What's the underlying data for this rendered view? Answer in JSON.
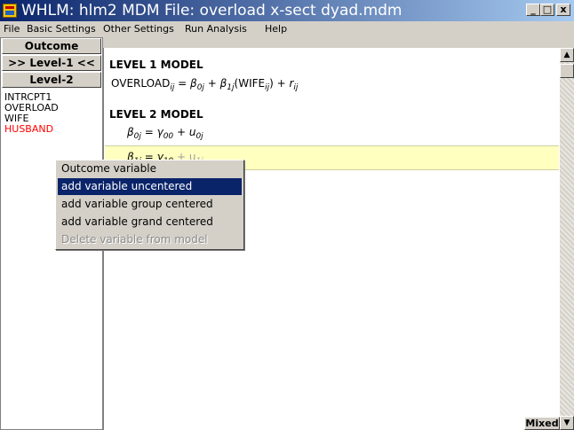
{
  "window": {
    "title": "WHLM: hlm2 MDM File: overload x-sect dyad.mdm",
    "controls": {
      "minimize": "_",
      "maximize": "□",
      "close": "x"
    },
    "title_gradient": [
      "#0a246a",
      "#a6caf0"
    ]
  },
  "menubar": [
    "File",
    "Basic Settings",
    "Other Settings",
    "Run Analysis",
    "Help"
  ],
  "left_panel": {
    "buttons": {
      "outcome": "Outcome",
      "level1": ">> Level-1 <<",
      "level2": "Level-2"
    },
    "variables": [
      "INTRCPT1",
      "OVERLOAD",
      "WIFE",
      "HUSBAND"
    ],
    "highlight_color": "#ff0000"
  },
  "model": {
    "level1_header": "LEVEL 1 MODEL",
    "level1_eq": {
      "lhs": "OVERLOAD",
      "lhs_sub": "ij",
      "b0": "β",
      "b0_sub": "0j",
      "b1": "β",
      "b1_sub": "1j",
      "var": "(WIFE",
      "var_sub": "ij",
      "var_close": ")",
      "r": "r",
      "r_sub": "ij"
    },
    "level2_header": "LEVEL 2 MODEL",
    "level2_eq1": {
      "b": "β",
      "b_sub": "0j",
      "g": "γ",
      "g_sub": "00",
      "u": "u",
      "u_sub": "0j"
    },
    "level2_eq2": {
      "b": "β",
      "b_sub": "1j",
      "g": "γ",
      "g_sub": "10",
      "tail": "+ u",
      "tail_sub": "1j"
    }
  },
  "context_menu": {
    "items": [
      "Outcome variable",
      "add variable uncentered",
      "add variable group centered",
      "add variable grand centered",
      "Delete variable from model"
    ],
    "selected_index": 1,
    "disabled_index": 4,
    "selection_color": "#0a246a"
  },
  "status": {
    "mixed_label": "Mixed"
  }
}
